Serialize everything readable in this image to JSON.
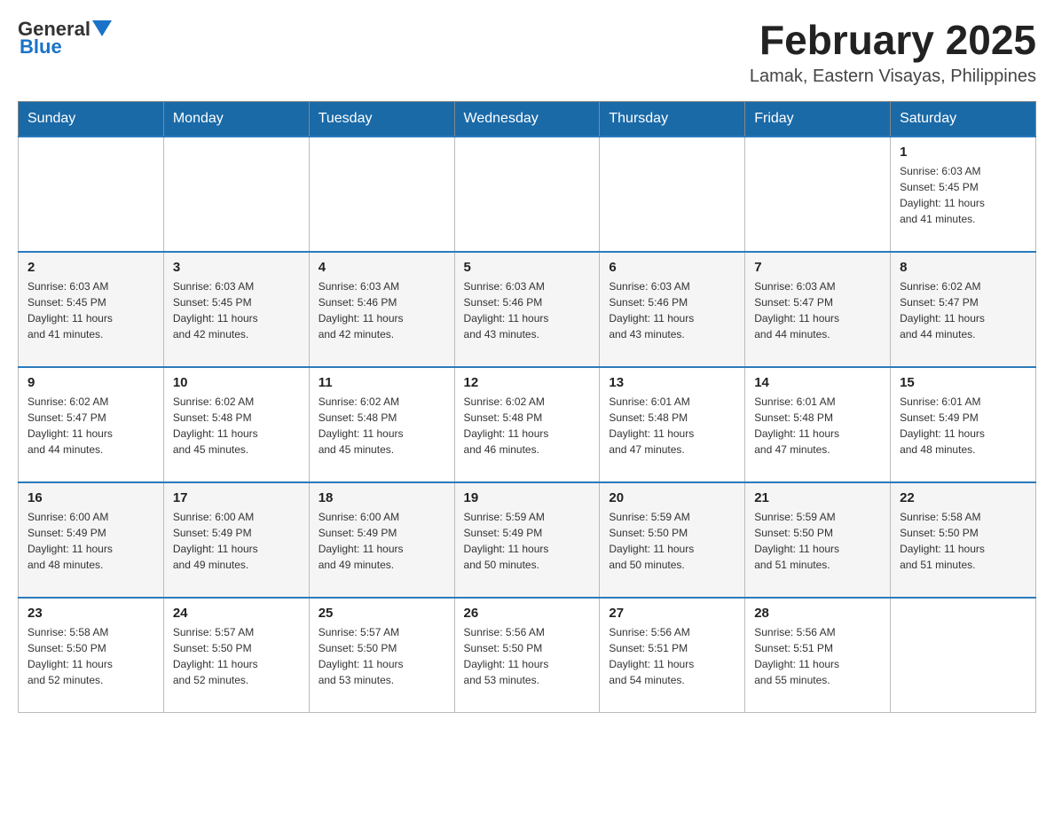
{
  "logo": {
    "general": "General",
    "blue": "Blue"
  },
  "title": "February 2025",
  "location": "Lamak, Eastern Visayas, Philippines",
  "weekdays": [
    "Sunday",
    "Monday",
    "Tuesday",
    "Wednesday",
    "Thursday",
    "Friday",
    "Saturday"
  ],
  "weeks": [
    [
      {
        "day": "",
        "info": ""
      },
      {
        "day": "",
        "info": ""
      },
      {
        "day": "",
        "info": ""
      },
      {
        "day": "",
        "info": ""
      },
      {
        "day": "",
        "info": ""
      },
      {
        "day": "",
        "info": ""
      },
      {
        "day": "1",
        "info": "Sunrise: 6:03 AM\nSunset: 5:45 PM\nDaylight: 11 hours\nand 41 minutes."
      }
    ],
    [
      {
        "day": "2",
        "info": "Sunrise: 6:03 AM\nSunset: 5:45 PM\nDaylight: 11 hours\nand 41 minutes."
      },
      {
        "day": "3",
        "info": "Sunrise: 6:03 AM\nSunset: 5:45 PM\nDaylight: 11 hours\nand 42 minutes."
      },
      {
        "day": "4",
        "info": "Sunrise: 6:03 AM\nSunset: 5:46 PM\nDaylight: 11 hours\nand 42 minutes."
      },
      {
        "day": "5",
        "info": "Sunrise: 6:03 AM\nSunset: 5:46 PM\nDaylight: 11 hours\nand 43 minutes."
      },
      {
        "day": "6",
        "info": "Sunrise: 6:03 AM\nSunset: 5:46 PM\nDaylight: 11 hours\nand 43 minutes."
      },
      {
        "day": "7",
        "info": "Sunrise: 6:03 AM\nSunset: 5:47 PM\nDaylight: 11 hours\nand 44 minutes."
      },
      {
        "day": "8",
        "info": "Sunrise: 6:02 AM\nSunset: 5:47 PM\nDaylight: 11 hours\nand 44 minutes."
      }
    ],
    [
      {
        "day": "9",
        "info": "Sunrise: 6:02 AM\nSunset: 5:47 PM\nDaylight: 11 hours\nand 44 minutes."
      },
      {
        "day": "10",
        "info": "Sunrise: 6:02 AM\nSunset: 5:48 PM\nDaylight: 11 hours\nand 45 minutes."
      },
      {
        "day": "11",
        "info": "Sunrise: 6:02 AM\nSunset: 5:48 PM\nDaylight: 11 hours\nand 45 minutes."
      },
      {
        "day": "12",
        "info": "Sunrise: 6:02 AM\nSunset: 5:48 PM\nDaylight: 11 hours\nand 46 minutes."
      },
      {
        "day": "13",
        "info": "Sunrise: 6:01 AM\nSunset: 5:48 PM\nDaylight: 11 hours\nand 47 minutes."
      },
      {
        "day": "14",
        "info": "Sunrise: 6:01 AM\nSunset: 5:48 PM\nDaylight: 11 hours\nand 47 minutes."
      },
      {
        "day": "15",
        "info": "Sunrise: 6:01 AM\nSunset: 5:49 PM\nDaylight: 11 hours\nand 48 minutes."
      }
    ],
    [
      {
        "day": "16",
        "info": "Sunrise: 6:00 AM\nSunset: 5:49 PM\nDaylight: 11 hours\nand 48 minutes."
      },
      {
        "day": "17",
        "info": "Sunrise: 6:00 AM\nSunset: 5:49 PM\nDaylight: 11 hours\nand 49 minutes."
      },
      {
        "day": "18",
        "info": "Sunrise: 6:00 AM\nSunset: 5:49 PM\nDaylight: 11 hours\nand 49 minutes."
      },
      {
        "day": "19",
        "info": "Sunrise: 5:59 AM\nSunset: 5:49 PM\nDaylight: 11 hours\nand 50 minutes."
      },
      {
        "day": "20",
        "info": "Sunrise: 5:59 AM\nSunset: 5:50 PM\nDaylight: 11 hours\nand 50 minutes."
      },
      {
        "day": "21",
        "info": "Sunrise: 5:59 AM\nSunset: 5:50 PM\nDaylight: 11 hours\nand 51 minutes."
      },
      {
        "day": "22",
        "info": "Sunrise: 5:58 AM\nSunset: 5:50 PM\nDaylight: 11 hours\nand 51 minutes."
      }
    ],
    [
      {
        "day": "23",
        "info": "Sunrise: 5:58 AM\nSunset: 5:50 PM\nDaylight: 11 hours\nand 52 minutes."
      },
      {
        "day": "24",
        "info": "Sunrise: 5:57 AM\nSunset: 5:50 PM\nDaylight: 11 hours\nand 52 minutes."
      },
      {
        "day": "25",
        "info": "Sunrise: 5:57 AM\nSunset: 5:50 PM\nDaylight: 11 hours\nand 53 minutes."
      },
      {
        "day": "26",
        "info": "Sunrise: 5:56 AM\nSunset: 5:50 PM\nDaylight: 11 hours\nand 53 minutes."
      },
      {
        "day": "27",
        "info": "Sunrise: 5:56 AM\nSunset: 5:51 PM\nDaylight: 11 hours\nand 54 minutes."
      },
      {
        "day": "28",
        "info": "Sunrise: 5:56 AM\nSunset: 5:51 PM\nDaylight: 11 hours\nand 55 minutes."
      },
      {
        "day": "",
        "info": ""
      }
    ]
  ]
}
